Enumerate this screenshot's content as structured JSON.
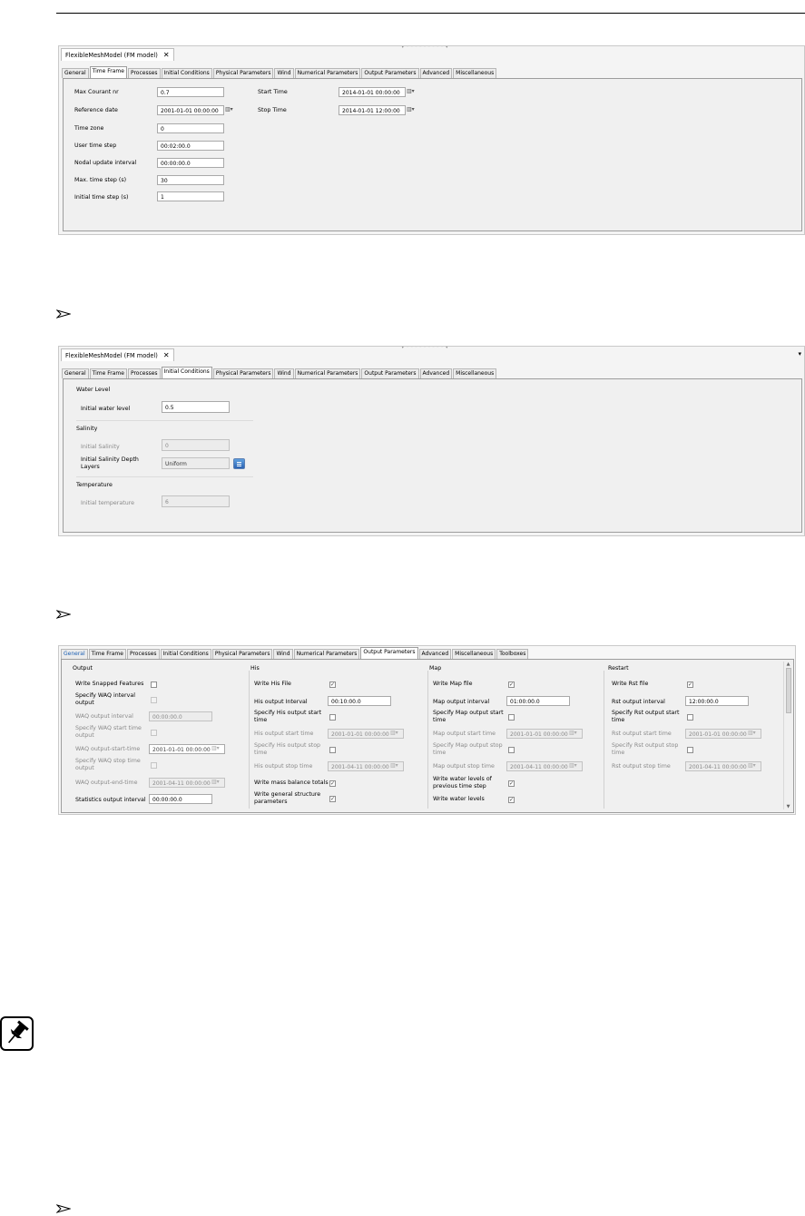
{
  "colors": {
    "panel_bg": "#f4f4f4",
    "active_tab": "#ffffff",
    "inactive_tab": "#ececec",
    "button_blue": "#2b63b3"
  },
  "shot1": {
    "doc_tab": "FlexibleMeshModel (FM model)",
    "close_glyph": "✕",
    "tabs": [
      "General",
      "Time Frame",
      "Processes",
      "Initial Conditions",
      "Physical Parameters",
      "Wind",
      "Numerical Parameters",
      "Output Parameters",
      "Advanced",
      "Miscellaneous"
    ],
    "active_tab": "Time Frame",
    "labels": {
      "max_courant": "Max Courant nr",
      "reference_date": "Reference date",
      "time_zone": "Time zone",
      "user_time_step": "User time step",
      "nodal_update": "Nodal update interval",
      "max_time_step": "Max. time step (s)",
      "initial_time_step": "Initial time step (s)",
      "start_time": "Start Time",
      "stop_time": "Stop Time"
    },
    "values": {
      "max_courant": "0.7",
      "reference_date": "2001-01-01 00:00:00",
      "time_zone": "0",
      "user_time_step": "00:02:00.0",
      "nodal_update": "00:00:00.0",
      "max_time_step": "30",
      "initial_time_step": "1",
      "start_time": "2014-01-01 00:00:00",
      "stop_time": "2014-01-01 12:00:00"
    }
  },
  "shot2": {
    "doc_tab": "FlexibleMeshModel (FM model)",
    "close_glyph": "✕",
    "tabs": [
      "General",
      "Time Frame",
      "Processes",
      "Initial Conditions",
      "Physical Parameters",
      "Wind",
      "Numerical Parameters",
      "Output Parameters",
      "Advanced",
      "Miscellaneous"
    ],
    "active_tab": "Initial Conditions",
    "sections": {
      "water_level": "Water Level",
      "salinity": "Salinity",
      "temperature": "Temperature"
    },
    "labels": {
      "initial_water_level": "Initial water level",
      "initial_salinity": "Initial Salinity",
      "salinity_depth_line1": "Initial Salinity Depth",
      "salinity_depth_line2": "Layers",
      "initial_temperature": "Initial temperature"
    },
    "values": {
      "initial_water_level": "0.5",
      "initial_salinity": "0",
      "salinity_depth": "Uniform",
      "initial_temperature": "6"
    }
  },
  "shot3": {
    "tabs": [
      "General",
      "Time Frame",
      "Processes",
      "Initial Conditions",
      "Physical Parameters",
      "Wind",
      "Numerical Parameters",
      "Output Parameters",
      "Advanced",
      "Miscellaneous",
      "Toolboxes"
    ],
    "active_tab": "Output Parameters",
    "output": {
      "title": "Output",
      "write_snapped": "Write Snapped Features",
      "specify_waq_interval_1": "Specify WAQ interval",
      "specify_waq_interval_2": "output",
      "waq_output_interval": "WAQ output interval",
      "waq_output_interval_value": "00:00:00.0",
      "specify_waq_start_1": "Specify WAQ start time",
      "specify_waq_start_2": "output",
      "waq_start": "WAQ output-start-time",
      "waq_start_value": "2001-01-01 00:00:00",
      "specify_waq_stop_1": "Specify WAQ stop time",
      "specify_waq_stop_2": "output",
      "waq_end": "WAQ output-end-time",
      "waq_end_value": "2001-04-11 00:00:00",
      "statistics_interval": "Statistics output interval",
      "statistics_value": "00:00:00.0"
    },
    "his": {
      "title": "His",
      "write_file": "Write His File",
      "output_interval": "His output Interval",
      "output_interval_value": "00:10:00.0",
      "specify_start_1": "Specify His output start",
      "specify_start_2": "time",
      "start_time": "His output start time",
      "start_value": "2001-01-01 00:00:00",
      "specify_stop_1": "Specify His output stop",
      "specify_stop_2": "time",
      "stop_time": "His output stop time",
      "stop_value": "2001-04-11 00:00:00",
      "mass_balance": "Write mass balance totals",
      "structure_1": "Write general structure",
      "structure_2": "parameters"
    },
    "map": {
      "title": "Map",
      "write_file": "Write Map file",
      "output_interval": "Map output interval",
      "output_interval_value": "01:00:00.0",
      "specify_start_1": "Specify Map output start",
      "specify_start_2": "time",
      "start_time": "Map output start time",
      "start_value": "2001-01-01 00:00:00",
      "specify_stop_1": "Specify Map output stop",
      "specify_stop_2": "time",
      "stop_time": "Map output stop time",
      "stop_value": "2001-04-11 00:00:00",
      "prev_levels_1": "Write water levels of",
      "prev_levels_2": "previous time step",
      "water_levels": "Write water levels"
    },
    "restart": {
      "title": "Restart",
      "write_file": "Write Rst file",
      "output_interval": "Rst output interval",
      "output_interval_value": "12:00:00.0",
      "specify_start_1": "Specify Rst output start",
      "specify_start_2": "time",
      "start_time": "Rst output start time",
      "start_value": "2001-01-01 00:00:00",
      "specify_stop_1": "Specify Rst output stop",
      "specify_stop_2": "time",
      "stop_time": "Rst output stop time",
      "stop_value": "2001-04-11 00:00:00"
    }
  },
  "icons": {
    "bullet": "arrowhead-bullet-icon",
    "note": "pushpin-icon"
  }
}
